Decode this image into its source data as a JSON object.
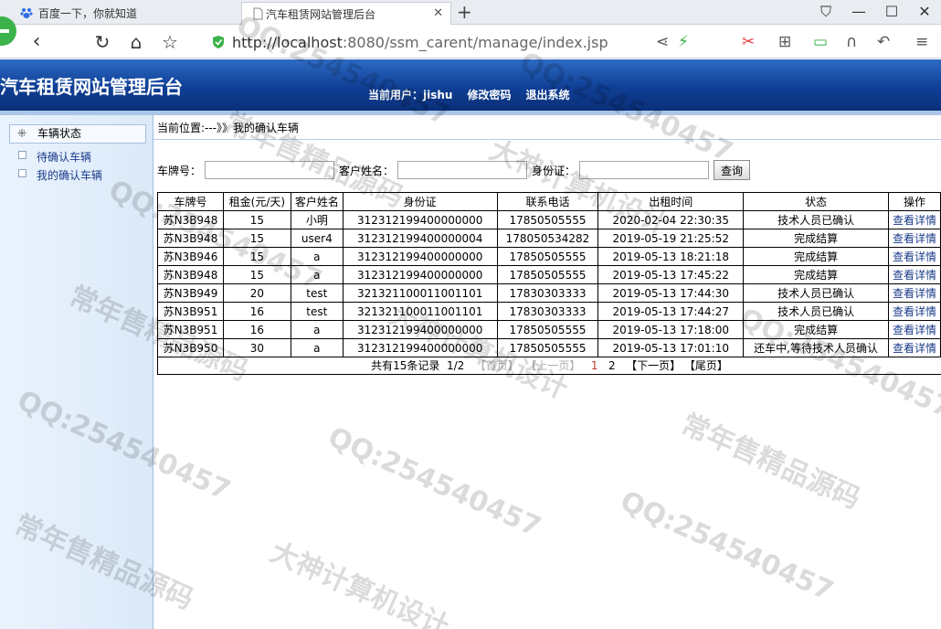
{
  "browser": {
    "tabs": [
      {
        "label": "百度一下，你就知道",
        "active": false
      },
      {
        "label": "汽车租赁网站管理后台",
        "active": true
      }
    ],
    "url_host": "http://localhost",
    "url_rest": ":8080/ssm_carent/manage/index.jsp"
  },
  "header": {
    "title": "汽车租赁网站管理后台",
    "current_user": "当前用户：jishu",
    "change_password": "修改密码",
    "logout": "退出系统"
  },
  "sidebar": {
    "section": "车辆状态",
    "items": [
      "待确认车辆",
      "我的确认车辆"
    ]
  },
  "breadcrumb": "当前位置:---》》我的确认车辆",
  "search": {
    "plate_label": "车牌号：",
    "customer_label": "客户姓名：",
    "idcard_label": "身份证：",
    "submit": "查询"
  },
  "table": {
    "headers": [
      "车牌号",
      "租金(元/天)",
      "客户姓名",
      "身份证",
      "联系电话",
      "出租时间",
      "状态",
      "操作"
    ],
    "rows": [
      [
        "苏N3B948",
        "15",
        "小明",
        "312312199400000000",
        "17850505555",
        "2020-02-04 22:30:35",
        "技术人员已确认",
        "查看详情"
      ],
      [
        "苏N3B948",
        "15",
        "user4",
        "312312199400000004",
        "178050534282",
        "2019-05-19 21:25:52",
        "完成结算",
        "查看详情"
      ],
      [
        "苏N3B946",
        "15",
        "a",
        "312312199400000000",
        "17850505555",
        "2019-05-13 18:21:18",
        "完成结算",
        "查看详情"
      ],
      [
        "苏N3B948",
        "15",
        "a",
        "312312199400000000",
        "17850505555",
        "2019-05-13 17:45:22",
        "完成结算",
        "查看详情"
      ],
      [
        "苏N3B949",
        "20",
        "test",
        "321321100011001101",
        "17830303333",
        "2019-05-13 17:44:30",
        "技术人员已确认",
        "查看详情"
      ],
      [
        "苏N3B951",
        "16",
        "test",
        "321321100011001101",
        "17830303333",
        "2019-05-13 17:44:27",
        "技术人员已确认",
        "查看详情"
      ],
      [
        "苏N3B951",
        "16",
        "a",
        "312312199400000000",
        "17850505555",
        "2019-05-13 17:18:00",
        "完成结算",
        "查看详情"
      ],
      [
        "苏N3B950",
        "30",
        "a",
        "312312199400000000",
        "17850505555",
        "2019-05-13 17:01:10",
        "还车中,等待技术人员确认",
        "查看详情"
      ]
    ]
  },
  "pager": {
    "summary": "共有15条记录",
    "page": "1/2",
    "first": "【首页】",
    "prev": "【上一页】",
    "p1": "1",
    "p2": "2",
    "next": "【下一页】",
    "last": "【尾页】"
  },
  "watermark": {
    "qq": "QQ:254540457",
    "shop": "常年售精品源码",
    "design": "大神计算机设计"
  },
  "colors": {
    "header_top": "#2e6bc4",
    "header_bottom": "#0a2f78",
    "link": "#1a3b8a"
  }
}
